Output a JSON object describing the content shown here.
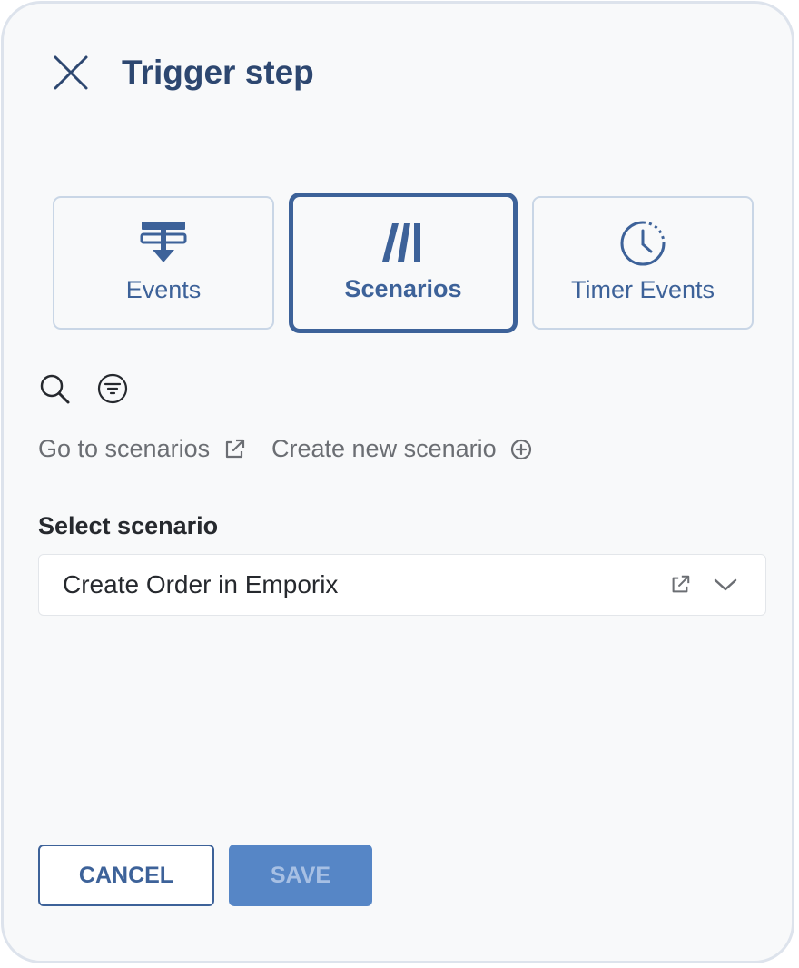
{
  "dialog": {
    "title": "Trigger step",
    "close_icon": "close-icon"
  },
  "tabs": [
    {
      "label": "Events",
      "icon": "events-icon",
      "active": false
    },
    {
      "label": "Scenarios",
      "icon": "scenarios-icon",
      "active": true
    },
    {
      "label": "Timer Events",
      "icon": "clock-icon",
      "active": false
    }
  ],
  "toolbar": {
    "search_icon": "search-icon",
    "filter_icon": "filter-icon"
  },
  "links": {
    "go_to_scenarios": "Go to scenarios",
    "create_new_scenario": "Create new scenario"
  },
  "select_scenario": {
    "label": "Select scenario",
    "value": "Create Order in Emporix"
  },
  "buttons": {
    "cancel": "CANCEL",
    "save": "SAVE"
  },
  "colors": {
    "primary": "#3d6299",
    "title": "#2d4770",
    "tab_border": "#c9d6e6",
    "save_disabled_bg": "#5686c6",
    "panel_bg": "#f8f9fa"
  }
}
